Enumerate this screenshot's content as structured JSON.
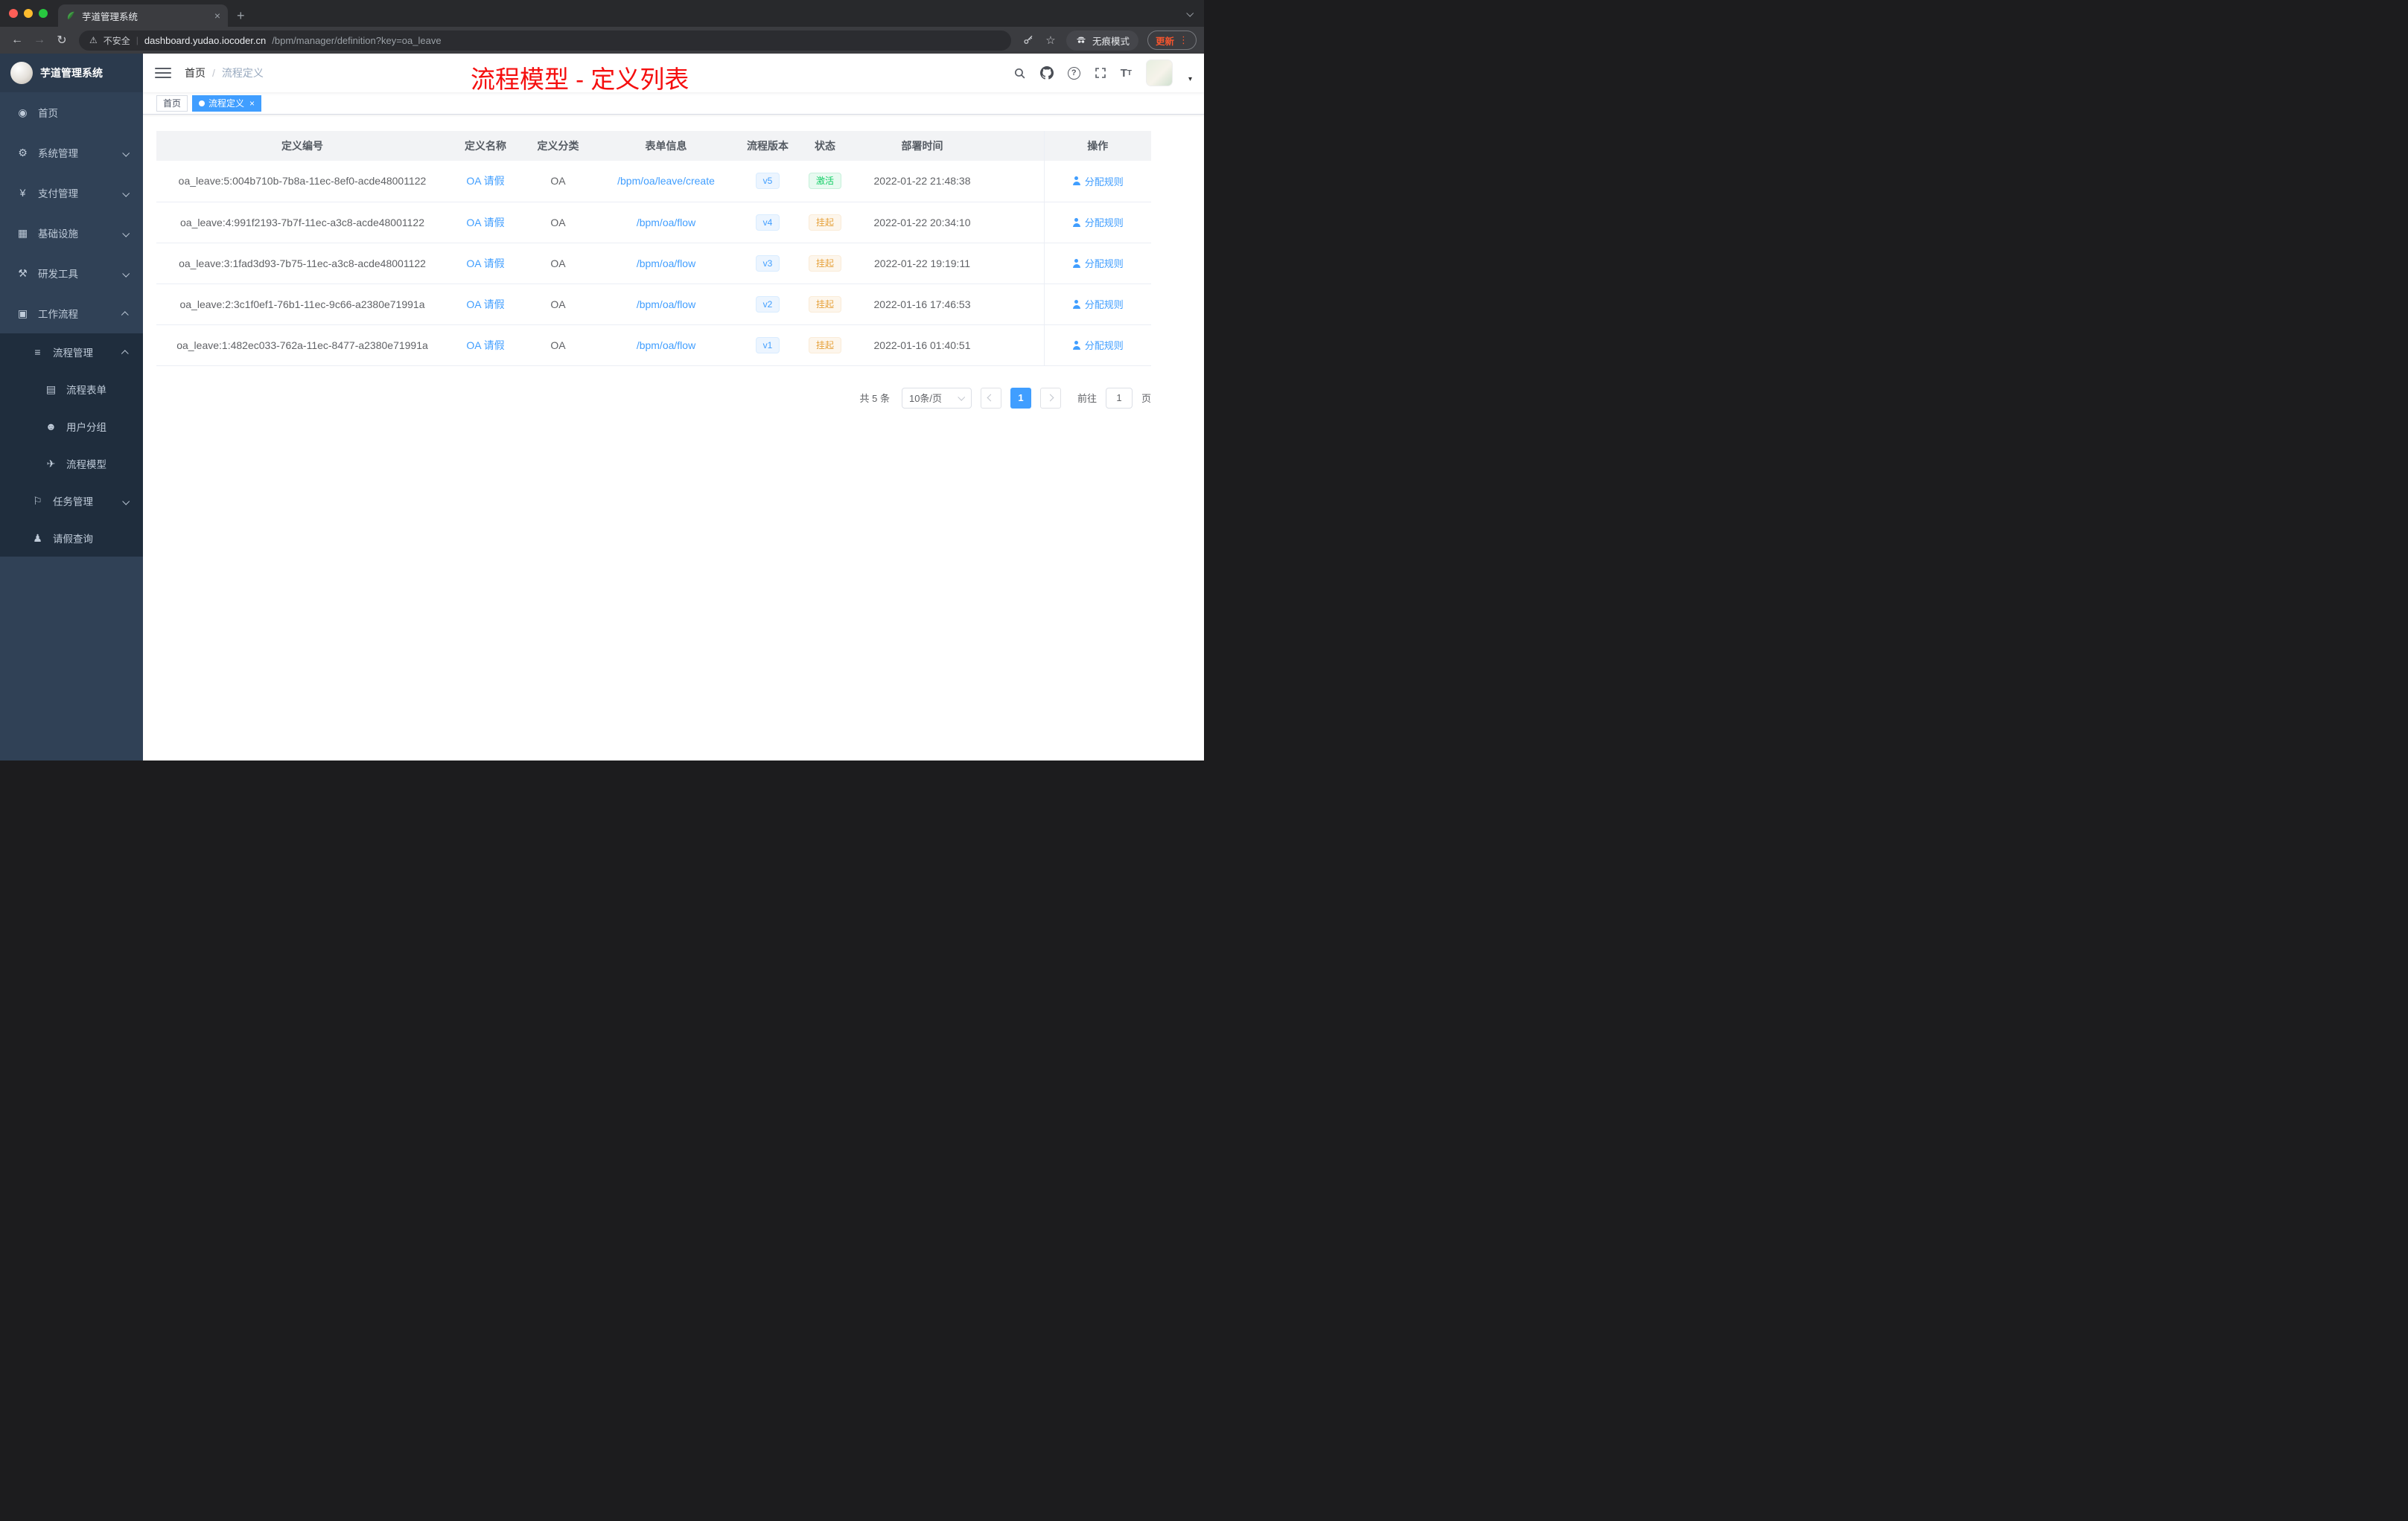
{
  "colors": {
    "accent_blue": "#409eff",
    "annotation_red": "#f50f0f",
    "sidebar_bg": "#304156",
    "submenu_bg": "#1f2d3d",
    "status_active_green": "#13ce66",
    "status_suspend_orange": "#e6a23c",
    "update_orange": "#f4552e"
  },
  "browser": {
    "tab": {
      "title": "芋道管理系统",
      "close": "×"
    },
    "new_tab": "+",
    "nav": {
      "back": "←",
      "forward": "→",
      "reload": "↻"
    },
    "omnibox": {
      "warning_icon": "⚠",
      "security_label": "不安全",
      "divider": "|",
      "url_host": "dashboard.yudao.iocoder.cn",
      "url_path": "/bpm/manager/definition?key=oa_leave",
      "star": "☆"
    },
    "profile": {
      "incognito_label": "无痕模式"
    },
    "update": {
      "label": "更新",
      "menu": "⋮"
    }
  },
  "sidebar": {
    "logo_title": "芋道管理系统",
    "items": [
      {
        "label": "首页",
        "glyph": "◉"
      },
      {
        "label": "系统管理",
        "glyph": "⚙"
      },
      {
        "label": "支付管理",
        "glyph": "¥"
      },
      {
        "label": "基础设施",
        "glyph": "▦"
      },
      {
        "label": "研发工具",
        "glyph": "⚒"
      },
      {
        "label": "工作流程",
        "glyph": "▣"
      },
      {
        "label": "流程管理",
        "glyph": "≡"
      },
      {
        "label": "流程表单",
        "glyph": "▤"
      },
      {
        "label": "用户分组",
        "glyph": "☻"
      },
      {
        "label": "流程模型",
        "glyph": "✈"
      },
      {
        "label": "任务管理",
        "glyph": "⚐"
      },
      {
        "label": "请假查询",
        "glyph": "♟"
      }
    ]
  },
  "header": {
    "breadcrumb": {
      "home": "首页",
      "separator": "/",
      "current": "流程定义"
    },
    "annotation": "流程模型 - 定义列表"
  },
  "tags": {
    "home": "首页",
    "active": "流程定义",
    "close": "×"
  },
  "table": {
    "columns": [
      "定义编号",
      "定义名称",
      "定义分类",
      "表单信息",
      "流程版本",
      "状态",
      "部署时间",
      "操作"
    ],
    "rows": [
      {
        "id": "oa_leave:5:004b710b-7b8a-11ec-8ef0-acde48001122",
        "name": "OA 请假",
        "category": "OA",
        "form": "/bpm/oa/leave/create",
        "version": "v5",
        "status": "激活",
        "deployed_at": "2022-01-22 21:48:38",
        "action": "分配规则"
      },
      {
        "id": "oa_leave:4:991f2193-7b7f-11ec-a3c8-acde48001122",
        "name": "OA 请假",
        "category": "OA",
        "form": "/bpm/oa/flow",
        "version": "v4",
        "status": "挂起",
        "deployed_at": "2022-01-22 20:34:10",
        "action": "分配规则"
      },
      {
        "id": "oa_leave:3:1fad3d93-7b75-11ec-a3c8-acde48001122",
        "name": "OA 请假",
        "category": "OA",
        "form": "/bpm/oa/flow",
        "version": "v3",
        "status": "挂起",
        "deployed_at": "2022-01-22 19:19:11",
        "action": "分配规则"
      },
      {
        "id": "oa_leave:2:3c1f0ef1-76b1-11ec-9c66-a2380e71991a",
        "name": "OA 请假",
        "category": "OA",
        "form": "/bpm/oa/flow",
        "version": "v2",
        "status": "挂起",
        "deployed_at": "2022-01-16 17:46:53",
        "action": "分配规则"
      },
      {
        "id": "oa_leave:1:482ec033-762a-11ec-8477-a2380e71991a",
        "name": "OA 请假",
        "category": "OA",
        "form": "/bpm/oa/flow",
        "version": "v1",
        "status": "挂起",
        "deployed_at": "2022-01-16 01:40:51",
        "action": "分配规则"
      }
    ]
  },
  "pagination": {
    "total": "共 5 条",
    "page_size": "10条/页",
    "current": "1",
    "goto": "前往",
    "goto_value": "1",
    "unit": "页"
  }
}
